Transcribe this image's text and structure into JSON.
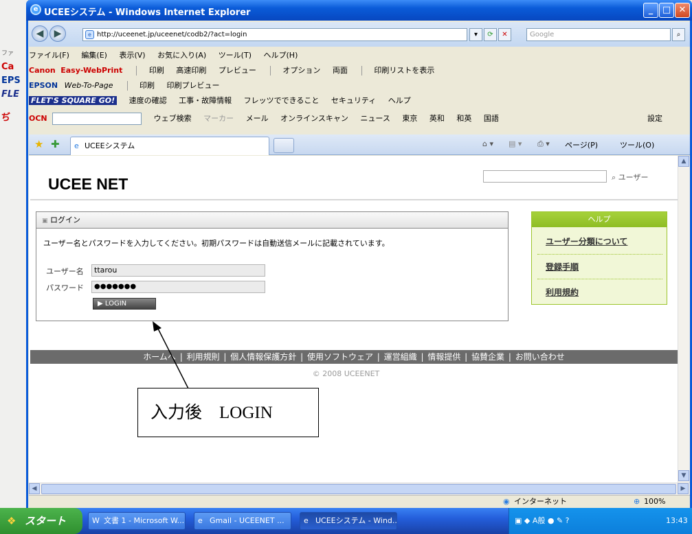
{
  "window": {
    "title": "UCEEシステム - Windows Internet Explorer"
  },
  "address": {
    "url": "http://uceenet.jp/uceenet/codb2/?act=login",
    "search_placeholder": "Google"
  },
  "menubar": [
    "ファイル(F)",
    "編集(E)",
    "表示(V)",
    "お気に入り(A)",
    "ツール(T)",
    "ヘルプ(H)"
  ],
  "toolbars": {
    "canon": {
      "brand": "Canon",
      "product": "Easy-WebPrint",
      "items": [
        "印刷",
        "高速印刷",
        "プレビュー",
        "オプション",
        "両面",
        "印刷リストを表示"
      ]
    },
    "epson": {
      "brand": "EPSON",
      "product": "Web-To-Page",
      "items": [
        "印刷",
        "印刷プレビュー"
      ]
    },
    "flets": {
      "brand": "FLET'S SQUARE GO!",
      "items": [
        "速度の確認",
        "工事・故障情報",
        "フレッツでできること",
        "セキュリティ",
        "ヘルプ"
      ]
    },
    "ocn": {
      "brand": "OCN",
      "items": [
        "ウェブ検索",
        "マーカー",
        "メール",
        "オンラインスキャン",
        "ニュース",
        "東京",
        "英和",
        "和英",
        "国語"
      ],
      "settings": "設定"
    }
  },
  "tabs": {
    "active": "UCEEシステム",
    "page_menu": "ページ(P)",
    "tools_menu": "ツール(O)"
  },
  "page": {
    "site_title": "UCEE NET",
    "search_link": "ユーザー",
    "login_panel": {
      "heading": "ログイン",
      "description": "ユーザー名とパスワードを入力してください。初期パスワードは自動送信メールに記載されています。",
      "username_label": "ユーザー名",
      "username_value": "ttarou",
      "password_label": "パスワード",
      "password_value": "●●●●●●●",
      "login_button": "▶ LOGIN"
    },
    "help": {
      "heading": "ヘルプ",
      "items": [
        "ユーザー分類について",
        "登録手順",
        "利用規約"
      ]
    },
    "footer_links": [
      "ホームへ",
      "利用規則",
      "個人情報保護方針",
      "使用ソフトウェア",
      "運営組織",
      "情報提供",
      "協賛企業",
      "お問い合わせ"
    ],
    "copyright": "© 2008 UCEENET"
  },
  "annotation": {
    "callout": "入力後　LOGIN"
  },
  "statusbar": {
    "zone": "インターネット",
    "zoom": "100%"
  },
  "taskbar": {
    "start": "スタート",
    "tasks": [
      "文書 1 - Microsoft W...",
      "Gmail - UCEENET ...",
      "UCEEシステム - Wind..."
    ],
    "clock": "13:43"
  }
}
